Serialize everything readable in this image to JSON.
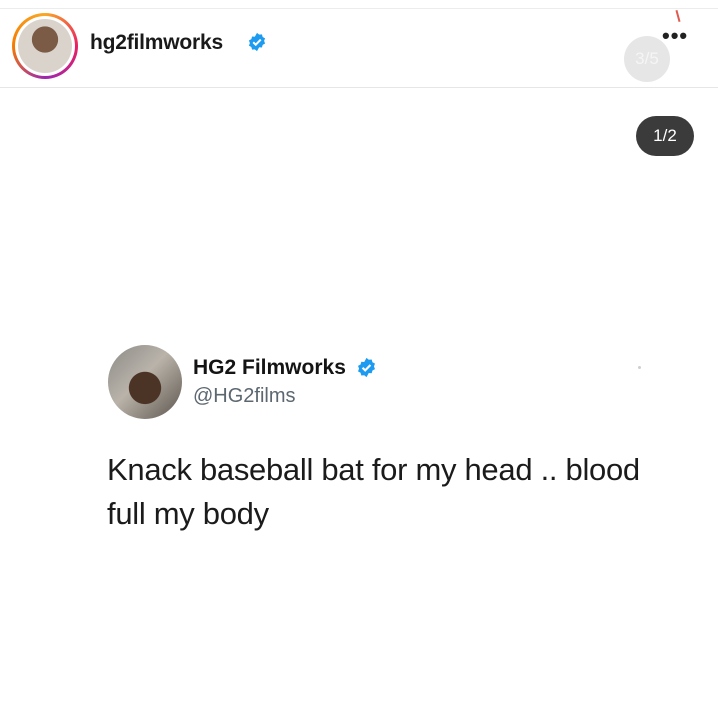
{
  "post_header": {
    "username": "hg2filmworks",
    "more_icon": "more-horizontal-icon",
    "carousel_counter": "3/5"
  },
  "tweet_counter": "1/2",
  "tweet": {
    "display_name": "HG2 Filmworks",
    "handle": "@HG2films",
    "text": "Knack baseball bat for my head .. blood full my body"
  },
  "colors": {
    "verified_badge": "#1d9bf0",
    "counter_dark": "#3b3b3b",
    "handle_gray": "#5c6770"
  }
}
